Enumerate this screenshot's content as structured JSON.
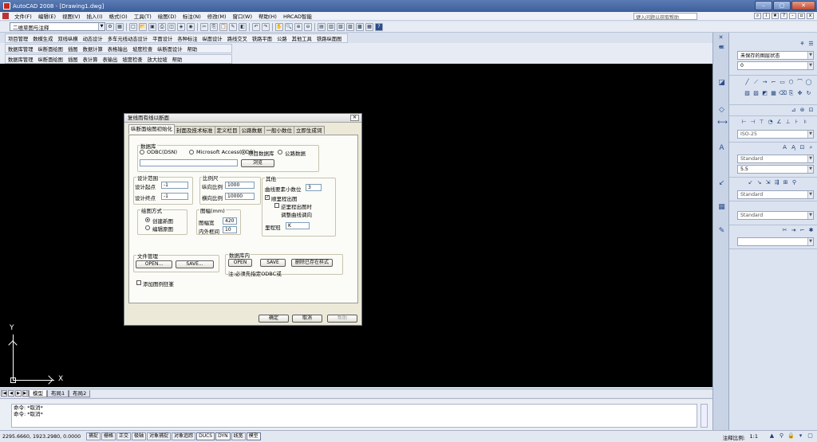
{
  "window": {
    "title": "AutoCAD 2008 - [Drawing1.dwg]"
  },
  "menu": {
    "items": [
      "文件(F)",
      "编辑(E)",
      "视图(V)",
      "插入(I)",
      "格式(O)",
      "工具(T)",
      "绘图(D)",
      "标注(N)",
      "修改(M)",
      "窗口(W)",
      "帮助(H)",
      "HRCAD智能"
    ],
    "help_search_placeholder": "键入问题以获取帮助"
  },
  "toolbar": {
    "workspace": "二维草图与注释"
  },
  "custom_toolbars": {
    "row1": [
      "项目管理",
      "数模生成",
      "双线纵横",
      "动态设计",
      "多车元线动态设计",
      "平面设计",
      "各种标注",
      "纵面设计",
      "路线交叉",
      "铁路平面",
      "公路",
      "其他工具",
      "铁路纵面图"
    ],
    "row2": [
      "数据库管理",
      "纵断面绘图",
      "插图",
      "数据计算",
      "表格输出",
      "坡度检查",
      "纵断面设计",
      "帮助"
    ],
    "row3": [
      "数据库管理",
      "纵断面绘图",
      "插图",
      "表计算",
      "表输出",
      "坡度检查",
      "放大拉坡",
      "帮助"
    ]
  },
  "ucs": {
    "y": "Y",
    "x": "X"
  },
  "layout_tabs": [
    "模型",
    "布局1",
    "布局2"
  ],
  "command": {
    "lines": [
      "命令: *取消*",
      "命令: *取消*"
    ]
  },
  "status": {
    "coords": "2295.6660, 1923.2980, 0.0000",
    "buttons": [
      "捕捉",
      "栅格",
      "正交",
      "极轴",
      "对象捕捉",
      "对象追踪",
      "DUCS",
      "DYN",
      "线宽",
      "模型"
    ],
    "annotation_scale_label": "注释比例:",
    "annotation_scale": "1:1"
  },
  "palette": {
    "layer_state": "未保存的图层状态",
    "layer_value": "0",
    "dim_style": "ISO-25",
    "text_style": "Standard",
    "text_height": "5.5",
    "table_style": "Standard",
    "multileader_style": "Standard"
  },
  "dialog": {
    "title": "复线而有线以断面",
    "tabs": [
      "纵断面绘图初始化",
      "封面及技术标准",
      "定义栏目",
      "公路数据",
      "一般小数位",
      "立即生成词"
    ],
    "database": {
      "group": "数据库",
      "opt_odbc": "ODBC(DSN)",
      "opt_access": "Microsoft Access(MDB)",
      "opt_project": "项目数据库",
      "opt_public": "公路数据",
      "browse": "浏览"
    },
    "design_range": {
      "group": "设计范围",
      "start_label": "设计起点",
      "start_value": "-1",
      "end_label": "设计终点",
      "end_value": "-1"
    },
    "scale": {
      "group": "比例尺",
      "v_label": "纵向比例",
      "v_value": "1000",
      "h_label": "横向比例",
      "h_value": "10000"
    },
    "other": {
      "group": "其他",
      "decimals_label": "曲线要素小数位",
      "decimals_value": "3",
      "mileage_plot": "顺里程出图",
      "reverse_plot": "逆里程出图时",
      "adjust_dir": "调整曲线调向",
      "mileage_label": "里程冠",
      "mileage_value": "K"
    },
    "draw_mode": {
      "group": "绘图方式",
      "new": "创建新图",
      "edit": "编辑原图"
    },
    "frame": {
      "group": "图幅(mm)",
      "width_label": "图幅宽",
      "width_value": "420",
      "gap_label": "内外框间",
      "gap_value": "10"
    },
    "file_mgmt": {
      "group": "文件管理",
      "open": "OPEN...",
      "save": "SAVE..."
    },
    "db_inner": {
      "group": "数据库内",
      "open": "OPEN",
      "save": "SAVE",
      "delete": "删除已存在样式",
      "note": "注:必须先指定ODBC或"
    },
    "add_frame": "添加图例狂峯",
    "buttons": {
      "ok": "确定",
      "cancel": "取消",
      "help": "帮助"
    }
  }
}
